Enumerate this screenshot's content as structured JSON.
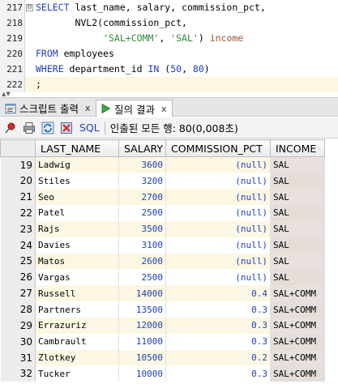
{
  "editor": {
    "lines": [
      {
        "num": "217",
        "fold": "⊟",
        "tokens": [
          {
            "t": "SELECT",
            "c": "kw"
          },
          {
            "t": " last_name, salary, commission_pct,",
            "c": ""
          }
        ]
      },
      {
        "num": "218",
        "fold": "",
        "tokens": [
          {
            "t": "       NVL2(commission_pct,",
            "c": ""
          }
        ]
      },
      {
        "num": "219",
        "fold": "",
        "tokens": [
          {
            "t": "            ",
            "c": ""
          },
          {
            "t": "'SAL+COMM'",
            "c": "str"
          },
          {
            "t": ", ",
            "c": ""
          },
          {
            "t": "'SAL'",
            "c": "str"
          },
          {
            "t": ") ",
            "c": ""
          },
          {
            "t": "income",
            "c": "alias"
          }
        ]
      },
      {
        "num": "220",
        "fold": "",
        "tokens": [
          {
            "t": "FROM",
            "c": "kw"
          },
          {
            "t": " employees",
            "c": ""
          }
        ]
      },
      {
        "num": "221",
        "fold": "",
        "tokens": [
          {
            "t": "WHERE",
            "c": "kw"
          },
          {
            "t": " department_id ",
            "c": ""
          },
          {
            "t": "IN",
            "c": "kw"
          },
          {
            "t": " (",
            "c": ""
          },
          {
            "t": "50",
            "c": "num"
          },
          {
            "t": ", ",
            "c": ""
          },
          {
            "t": "80",
            "c": "num"
          },
          {
            "t": ")",
            "c": ""
          }
        ]
      },
      {
        "num": "222",
        "fold": "",
        "tokens": [
          {
            "t": ";",
            "c": ""
          }
        ]
      }
    ]
  },
  "tabs": [
    {
      "label": "스크립트 출력",
      "close": "x",
      "active": false
    },
    {
      "label": "질의 결과",
      "close": "x",
      "active": true
    }
  ],
  "toolbar": {
    "sql_label": "SQL",
    "separator": "|",
    "status": "인출된 모든 행: 80(0,008초)"
  },
  "grid": {
    "columns": [
      "LAST_NAME",
      "SALARY",
      "COMMISSION_PCT",
      "INCOME"
    ],
    "rows": [
      {
        "n": "19",
        "last_name": "Ladwig",
        "salary": "3600",
        "commission_pct": "(null)",
        "income": "SAL"
      },
      {
        "n": "20",
        "last_name": "Stiles",
        "salary": "3200",
        "commission_pct": "(null)",
        "income": "SAL"
      },
      {
        "n": "21",
        "last_name": "Seo",
        "salary": "2700",
        "commission_pct": "(null)",
        "income": "SAL"
      },
      {
        "n": "22",
        "last_name": "Patel",
        "salary": "2500",
        "commission_pct": "(null)",
        "income": "SAL"
      },
      {
        "n": "23",
        "last_name": "Rajs",
        "salary": "3500",
        "commission_pct": "(null)",
        "income": "SAL"
      },
      {
        "n": "24",
        "last_name": "Davies",
        "salary": "3100",
        "commission_pct": "(null)",
        "income": "SAL"
      },
      {
        "n": "25",
        "last_name": "Matos",
        "salary": "2600",
        "commission_pct": "(null)",
        "income": "SAL"
      },
      {
        "n": "26",
        "last_name": "Vargas",
        "salary": "2500",
        "commission_pct": "(null)",
        "income": "SAL"
      },
      {
        "n": "27",
        "last_name": "Russell",
        "salary": "14000",
        "commission_pct": "0.4",
        "income": "SAL+COMM"
      },
      {
        "n": "28",
        "last_name": "Partners",
        "salary": "13500",
        "commission_pct": "0.3",
        "income": "SAL+COMM"
      },
      {
        "n": "29",
        "last_name": "Errazuriz",
        "salary": "12000",
        "commission_pct": "0.3",
        "income": "SAL+COMM"
      },
      {
        "n": "30",
        "last_name": "Cambrault",
        "salary": "11000",
        "commission_pct": "0.3",
        "income": "SAL+COMM"
      },
      {
        "n": "31",
        "last_name": "Zlotkey",
        "salary": "10500",
        "commission_pct": "0.2",
        "income": "SAL+COMM"
      },
      {
        "n": "32",
        "last_name": "Tucker",
        "salary": "10000",
        "commission_pct": "0.3",
        "income": "SAL+COMM"
      }
    ]
  },
  "icons": [
    "pin-icon",
    "print-icon",
    "refresh-icon",
    "delete-icon"
  ]
}
